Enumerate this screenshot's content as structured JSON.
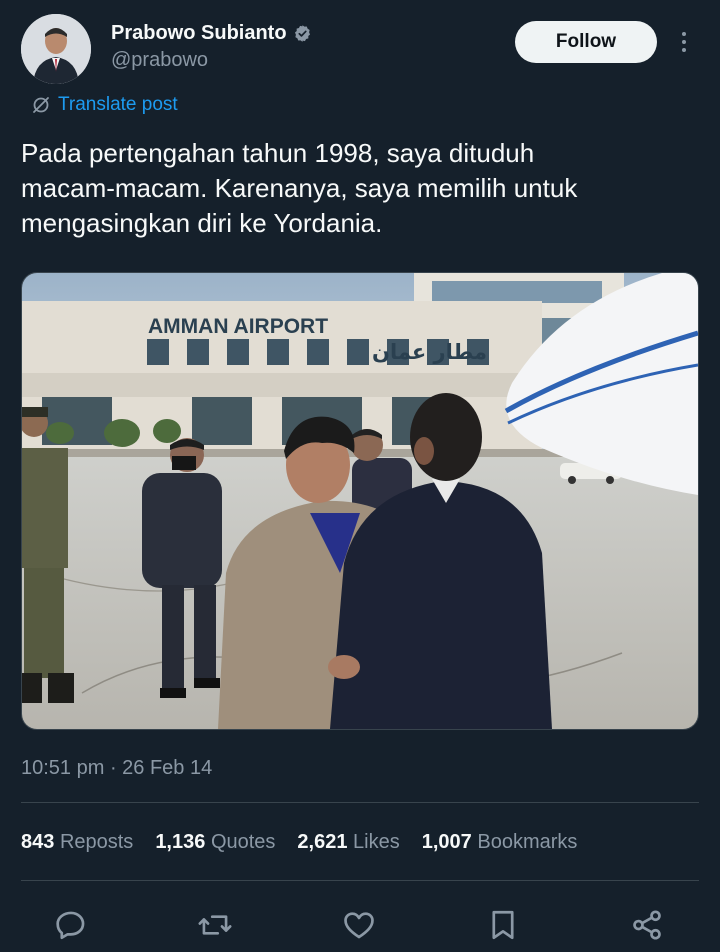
{
  "author": {
    "display_name": "Prabowo Subianto",
    "handle": "@prabowo",
    "verified": true
  },
  "follow_button": {
    "label": "Follow"
  },
  "translate": {
    "label": "Translate post"
  },
  "post": {
    "lines": [
      "Pada pertengahan tahun 1998, saya dituduh",
      "macam-macam. Karenanya, saya memilih untuk",
      "mengasingkan diri ke Yordania."
    ],
    "image": {
      "sign_latin": "AMMAN AIRPORT",
      "sign_arabic": "مطار عمان"
    },
    "timestamp": "10:51 pm · 26 Feb 14"
  },
  "stats": [
    {
      "count": "843",
      "label": "Reposts"
    },
    {
      "count": "1,136",
      "label": "Quotes"
    },
    {
      "count": "2,621",
      "label": "Likes"
    },
    {
      "count": "1,007",
      "label": "Bookmarks"
    }
  ],
  "actions": [
    "reply-icon",
    "repost-icon",
    "like-icon",
    "bookmark-icon",
    "share-icon"
  ],
  "colors": {
    "background": "#15202b",
    "text_primary": "#f7f9f9",
    "text_secondary": "#8b98a5",
    "accent": "#1d9bf0",
    "divider": "#38444d"
  }
}
